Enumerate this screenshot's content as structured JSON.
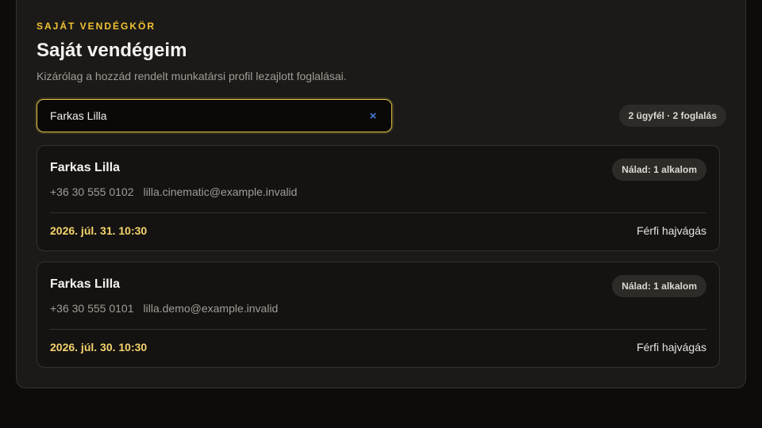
{
  "header": {
    "eyebrow": "SAJÁT VENDÉGKÖR",
    "title": "Saját vendégeim",
    "subtitle": "Kizárólag a hozzád rendelt munkatársi profil lezajlott foglalásai."
  },
  "search": {
    "value": "Farkas Lilla",
    "clear_icon": "×"
  },
  "summary": "2 ügyfél · 2 foglalás",
  "clients": [
    {
      "name": "Farkas Lilla",
      "badge": "Nálad: 1 alkalom",
      "phone": "+36 30 555 0102",
      "email": "lilla.cinematic@example.invalid",
      "date": "2026. júl. 31. 10:30",
      "service": "Férfi hajvágás"
    },
    {
      "name": "Farkas Lilla",
      "badge": "Nálad: 1 alkalom",
      "phone": "+36 30 555 0101",
      "email": "lilla.demo@example.invalid",
      "date": "2026. júl. 30. 10:30",
      "service": "Férfi hajvágás"
    }
  ],
  "colors": {
    "accent": "#f3c332",
    "date": "#f6d36e",
    "clear_icon": "#4a79d8"
  }
}
